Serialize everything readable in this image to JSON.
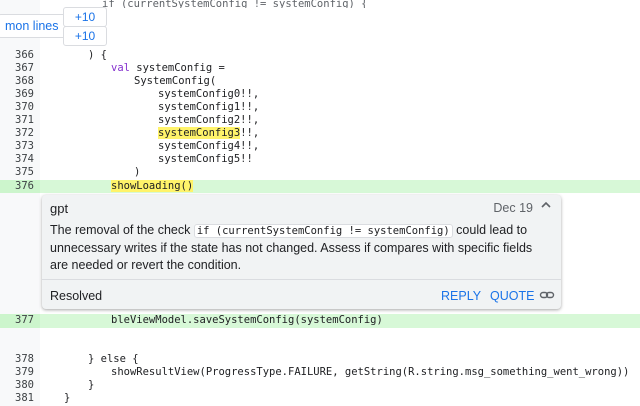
{
  "top_strip_text": "if (currentSystemConfig != systemConfig) {",
  "common_lines_label": "mon lines",
  "expand_above_label": "+10",
  "expand_below_label": "+10",
  "code_lines": [
    {
      "n": "366",
      "text": ") {"
    },
    {
      "n": "367",
      "kw": "val",
      "text": " systemConfig ="
    },
    {
      "n": "368",
      "text": "SystemConfig("
    },
    {
      "n": "369",
      "text": "systemConfig0!!,"
    },
    {
      "n": "370",
      "text": "systemConfig1!!,"
    },
    {
      "n": "371",
      "text": "systemConfig2!!,"
    },
    {
      "n": "372",
      "hl": "systemConfig3",
      "text": "!!,"
    },
    {
      "n": "373",
      "text": "systemConfig4!!,"
    },
    {
      "n": "374",
      "text": "systemConfig5!!"
    },
    {
      "n": "375",
      "text": ")"
    },
    {
      "n": "376",
      "hl": "showLoading()",
      "text": ""
    }
  ],
  "comment": {
    "author": "gpt",
    "date": "Dec 19",
    "message_before": "The removal of the check ",
    "message_code": "if (currentSystemConfig != systemConfig)",
    "message_after": " could lead to unnecessary writes if the state has not changed. Assess if compares with specific fields are needed or revert the condition.",
    "status": "Resolved",
    "reply_label": "REPLY",
    "quote_label": "QUOTE",
    "collapse_icon": "chevron-up-icon",
    "link_icon": "link-icon"
  },
  "line_377": {
    "n": "377",
    "text": "bleViewModel.saveSystemConfig(systemConfig)"
  },
  "tail_lines": [
    {
      "n": "378",
      "text": "} else {"
    },
    {
      "n": "379",
      "text": "showResultView(ProgressType.FAILURE, getString(R.string.msg_something_went_wrong))"
    },
    {
      "n": "380",
      "text": "}"
    },
    {
      "n": "381",
      "text": "}"
    }
  ],
  "colors": {
    "added_bg": "#d7f8d7",
    "highlight": "#fff36a",
    "link": "#1a73e8"
  }
}
